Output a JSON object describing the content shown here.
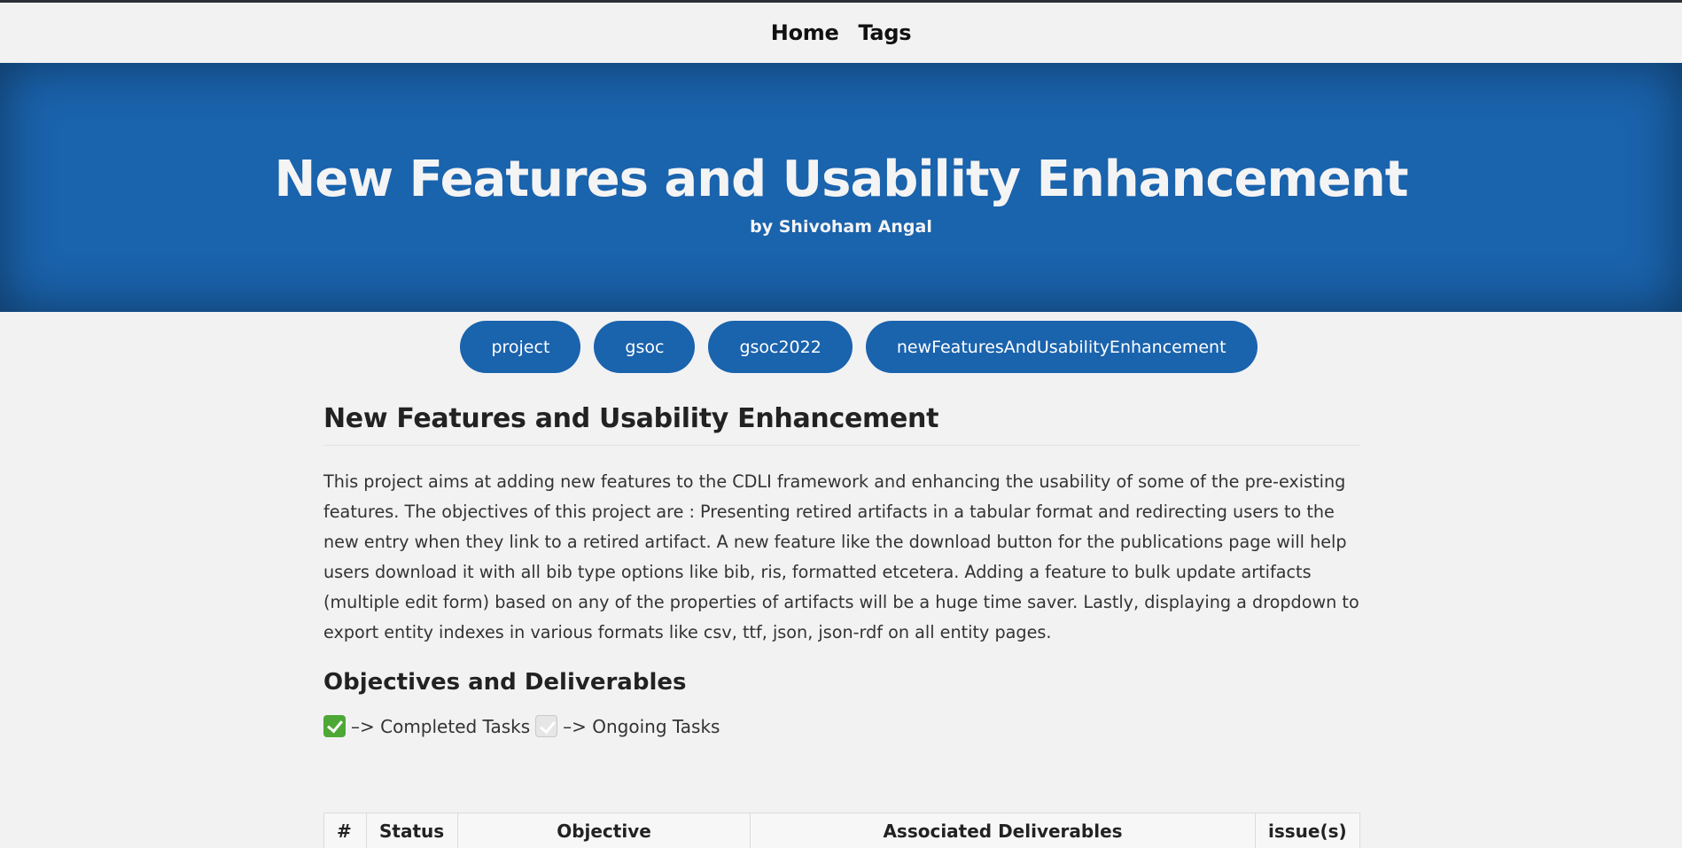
{
  "nav": {
    "items": [
      {
        "label": "Home"
      },
      {
        "label": "Tags"
      }
    ]
  },
  "hero": {
    "title": "New Features and Usability Enhancement",
    "author": "by Shivoham Angal"
  },
  "tags": [
    "project",
    "gsoc",
    "gsoc2022",
    "newFeaturesAndUsabilityEnhancement"
  ],
  "post": {
    "title": "New Features and Usability Enhancement",
    "body": "This project aims at adding new features to the CDLI framework and enhancing the usability of some of the pre-existing features. The objectives of this project are : Presenting retired artifacts in a tabular format and redirecting users to the new entry when they link to a retired artifact. A new feature like the download button for the publications page will help users download it with all bib type options like bib, ris, formatted etcetera. Adding a feature to bulk update artifacts (multiple edit form) based on any of the properties of artifacts will be a huge time saver. Lastly, displaying a dropdown to export entity indexes in various formats like csv, ttf, json, json-rdf on all entity pages.",
    "section_title": "Objectives and Deliverables",
    "legend": {
      "completed": "–> Completed Tasks",
      "ongoing": "–> Ongoing Tasks"
    },
    "table_headers": [
      "#",
      "Status",
      "Objective",
      "Associated Deliverables",
      "issue(s)"
    ]
  },
  "colors": {
    "brand": "#1a63ad",
    "completed": "#4ea836"
  }
}
